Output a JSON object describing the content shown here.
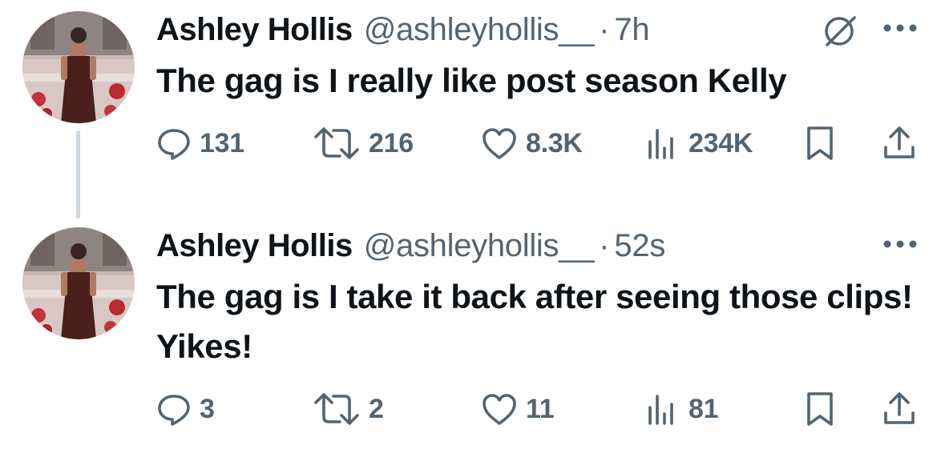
{
  "colors": {
    "text_primary": "#0f1419",
    "text_secondary": "#536471",
    "thread_line": "#cfd9de",
    "background": "#ffffff"
  },
  "tweets": [
    {
      "display_name": "Ashley Hollis",
      "handle": "@ashleyhollis__",
      "separator": "·",
      "time": "7h",
      "text": "The gag is I really like post season Kelly",
      "actions": {
        "reply_icon": "reply-icon",
        "reply_count": "131",
        "retweet_icon": "retweet-icon",
        "retweet_count": "216",
        "like_icon": "heart-icon",
        "like_count": "8.3K",
        "views_icon": "analytics-icon",
        "views_count": "234K",
        "bookmark_icon": "bookmark-icon",
        "share_icon": "share-icon"
      },
      "extra_icons": [
        "grok-icon",
        "more-icon"
      ]
    },
    {
      "display_name": "Ashley Hollis",
      "handle": "@ashleyhollis__",
      "separator": "·",
      "time": "52s",
      "text": "The gag is I take it back after seeing those clips! Yikes!",
      "actions": {
        "reply_icon": "reply-icon",
        "reply_count": "3",
        "retweet_icon": "retweet-icon",
        "retweet_count": "2",
        "like_icon": "heart-icon",
        "like_count": "11",
        "views_icon": "analytics-icon",
        "views_count": "81",
        "bookmark_icon": "bookmark-icon",
        "share_icon": "share-icon"
      },
      "extra_icons": [
        "more-icon"
      ]
    }
  ]
}
